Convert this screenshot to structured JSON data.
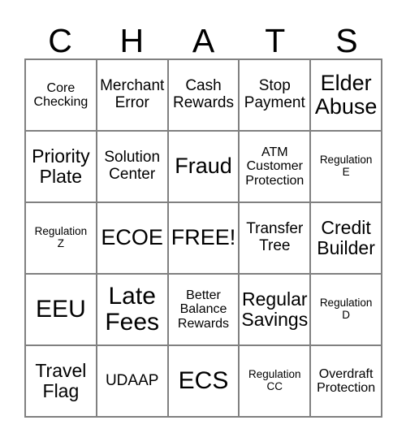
{
  "card": {
    "title_letters": [
      "C",
      "H",
      "A",
      "T",
      "S"
    ],
    "columns": 5,
    "rows": 5,
    "free_space": "FREE!",
    "colors": {
      "background": "#ffffff",
      "text": "#000000",
      "border": "#808080"
    },
    "cells": [
      {
        "text": "Core\nChecking",
        "size": "sm",
        "column": "C",
        "row": 1
      },
      {
        "text": "Merchant\nError",
        "size": "md",
        "column": "H",
        "row": 1
      },
      {
        "text": "Cash\nRewards",
        "size": "md",
        "column": "A",
        "row": 1
      },
      {
        "text": "Stop\nPayment",
        "size": "md",
        "column": "T",
        "row": 1
      },
      {
        "text": "Elder\nAbuse",
        "size": "xl",
        "column": "S",
        "row": 1
      },
      {
        "text": "Priority\nPlate",
        "size": "lg",
        "column": "C",
        "row": 2
      },
      {
        "text": "Solution\nCenter",
        "size": "md",
        "column": "H",
        "row": 2
      },
      {
        "text": "Fraud",
        "size": "xl",
        "column": "A",
        "row": 2
      },
      {
        "text": "ATM\nCustomer\nProtection",
        "size": "sm",
        "column": "T",
        "row": 2
      },
      {
        "text": "Regulation\nE",
        "size": "xs",
        "column": "S",
        "row": 2
      },
      {
        "text": "Regulation\nZ",
        "size": "xs",
        "column": "C",
        "row": 3
      },
      {
        "text": "ECOE",
        "size": "xl",
        "column": "H",
        "row": 3
      },
      {
        "text": "FREE!",
        "size": "xl",
        "column": "A",
        "row": 3
      },
      {
        "text": "Transfer\nTree",
        "size": "md",
        "column": "T",
        "row": 3
      },
      {
        "text": "Credit\nBuilder",
        "size": "lg",
        "column": "S",
        "row": 3
      },
      {
        "text": "EEU",
        "size": "xxl",
        "column": "C",
        "row": 4
      },
      {
        "text": "Late\nFees",
        "size": "xxl",
        "column": "H",
        "row": 4
      },
      {
        "text": "Better\nBalance\nRewards",
        "size": "sm",
        "column": "A",
        "row": 4
      },
      {
        "text": "Regular\nSavings",
        "size": "lg",
        "column": "T",
        "row": 4
      },
      {
        "text": "Regulation\nD",
        "size": "xs",
        "column": "S",
        "row": 4
      },
      {
        "text": "Travel\nFlag",
        "size": "lg",
        "column": "C",
        "row": 5
      },
      {
        "text": "UDAAP",
        "size": "md",
        "column": "H",
        "row": 5
      },
      {
        "text": "ECS",
        "size": "xxl",
        "column": "A",
        "row": 5
      },
      {
        "text": "Regulation\nCC",
        "size": "xs",
        "column": "T",
        "row": 5
      },
      {
        "text": "Overdraft\nProtection",
        "size": "sm",
        "column": "S",
        "row": 5
      }
    ]
  }
}
